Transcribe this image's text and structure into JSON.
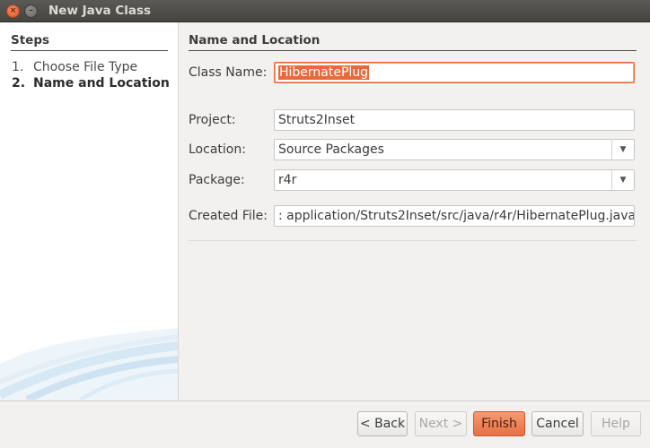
{
  "window": {
    "title": "New Java Class",
    "close_glyph": "×",
    "minimize_glyph": "–"
  },
  "steps": {
    "heading": "Steps",
    "items": [
      {
        "number": "1.",
        "label": "Choose File Type",
        "current": false
      },
      {
        "number": "2.",
        "label": "Name and Location",
        "current": true
      }
    ]
  },
  "form": {
    "section_title": "Name and Location",
    "class_name": {
      "label": "Class Name:",
      "value": "HibernatePlug",
      "state": "focused, text selected"
    },
    "project": {
      "label": "Project:",
      "value": "Struts2Inset"
    },
    "location": {
      "label": "Location:",
      "value": "Source Packages"
    },
    "package": {
      "label": "Package:",
      "value": "r4r"
    },
    "created_file": {
      "label": "Created File:",
      "value": ": application/Struts2Inset/src/java/r4r/HibernatePlug.java"
    }
  },
  "buttons": {
    "back": "< Back",
    "next": "Next >",
    "finish": "Finish",
    "cancel": "Cancel",
    "help": "Help"
  },
  "colors": {
    "accent": "#e9693a",
    "titlebar": "#4e4d48",
    "background": "#f2f1f0"
  },
  "icons": {
    "dropdown": "triangle-down"
  }
}
